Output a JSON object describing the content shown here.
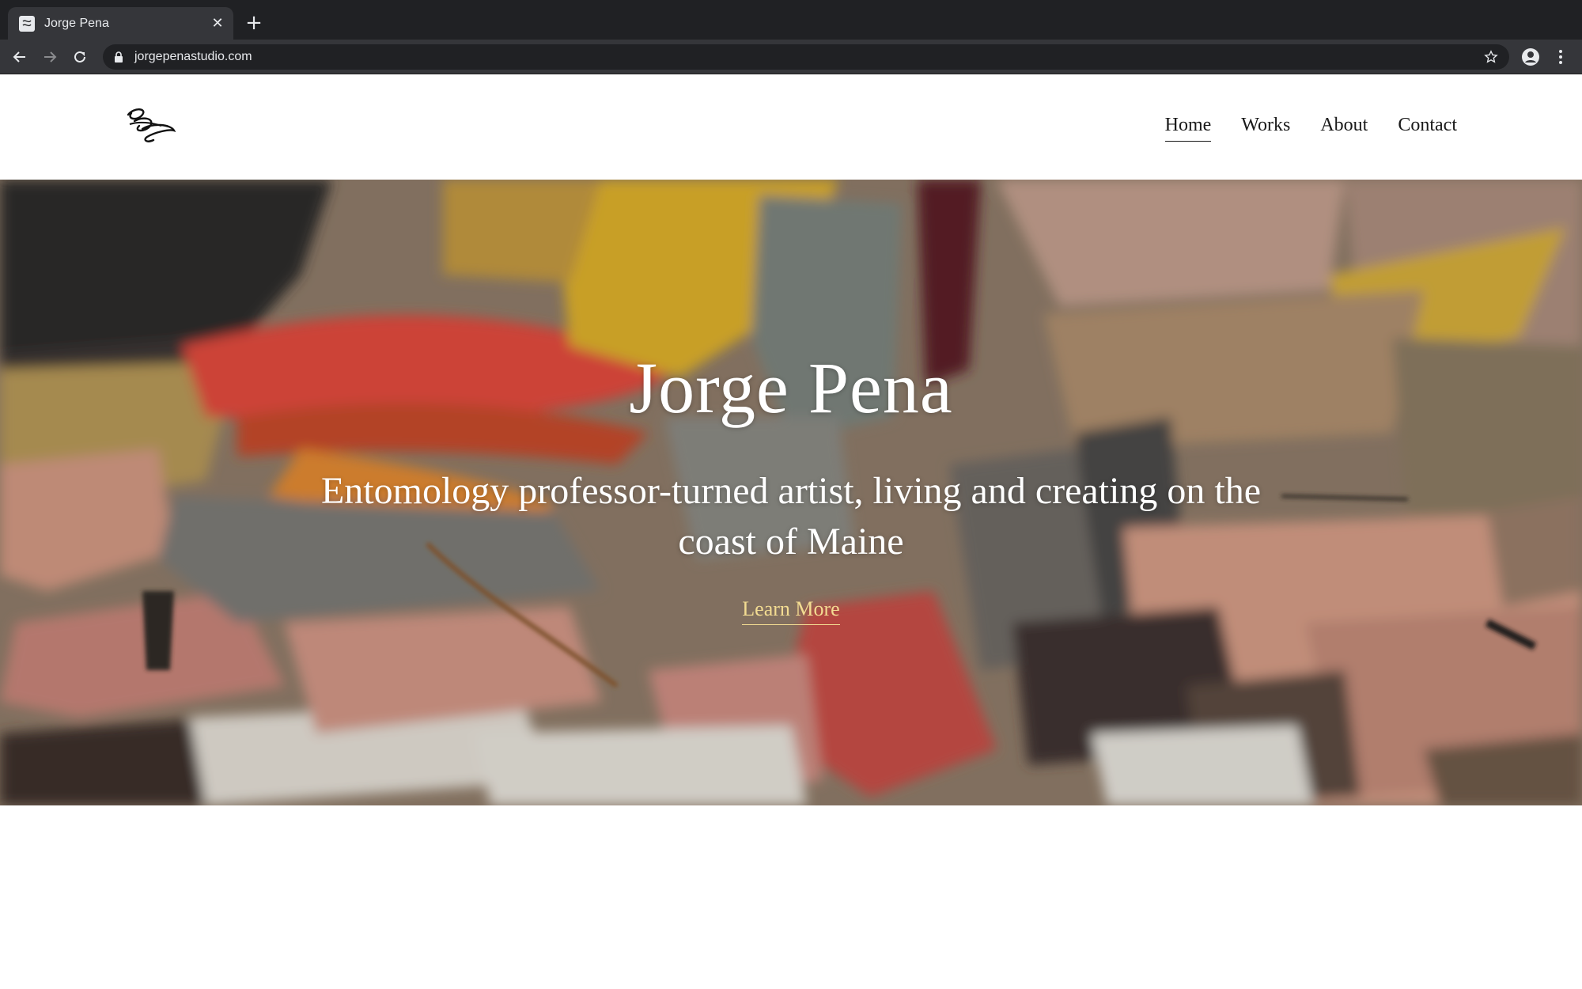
{
  "browser": {
    "tab_title": "Jorge Pena",
    "url": "jorgepenastudio.com"
  },
  "icons": {
    "back": "back-arrow-icon",
    "forward": "forward-arrow-icon",
    "reload": "reload-icon",
    "lock": "lock-icon",
    "bookmark": "star-icon",
    "profile": "account-circle-icon",
    "menu": "more-vert-icon"
  },
  "site": {
    "nav": [
      {
        "label": "Home",
        "active": true
      },
      {
        "label": "Works",
        "active": false
      },
      {
        "label": "About",
        "active": false
      },
      {
        "label": "Contact",
        "active": false
      }
    ]
  },
  "hero": {
    "title": "Jorge Pena",
    "subtitle": "Entomology professor-turned artist, living and creating on the coast of Maine",
    "cta": "Learn More"
  },
  "colors": {
    "chrome_dark": "#202124",
    "chrome_tab": "#35363a",
    "cta": "#f3dc92"
  }
}
